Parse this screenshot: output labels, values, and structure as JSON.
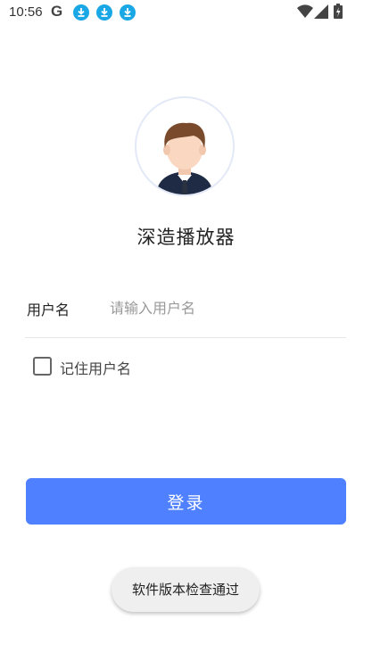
{
  "status_bar": {
    "time": "10:56",
    "icons": [
      "google-icon",
      "download-icon",
      "download-icon",
      "download-icon",
      "wifi-icon",
      "signal-icon",
      "battery-charging-icon"
    ],
    "accent": "#19a7e5"
  },
  "app": {
    "name": "深造播放器",
    "avatar_icon": "user-avatar-icon"
  },
  "form": {
    "username_label": "用户名",
    "username_placeholder": "请输入用户名",
    "username_value": "",
    "remember_label": "记住用户名",
    "remember_checked": false
  },
  "login_button": {
    "label": "登录",
    "color": "#4f80ff"
  },
  "toast": {
    "message": "软件版本检查通过"
  }
}
